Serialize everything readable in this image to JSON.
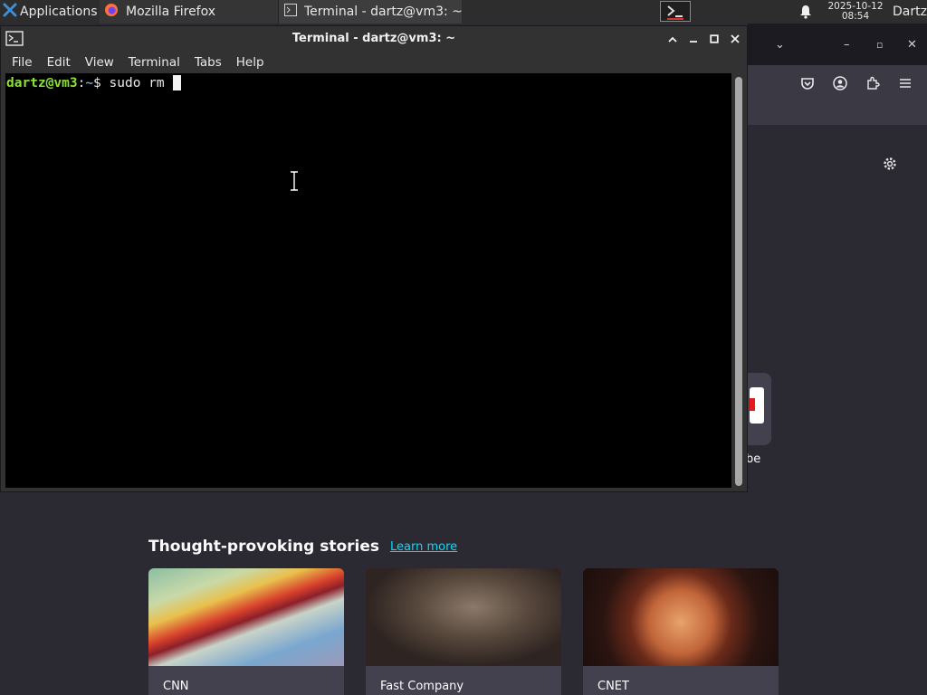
{
  "panel": {
    "applications_label": "Applications",
    "applications_arrow": "≡",
    "tasks": [
      {
        "label": "Mozilla Firefox",
        "icon": "firefox-icon"
      },
      {
        "label": "Terminal - dartz@vm3: ~",
        "icon": "terminal-icon"
      }
    ],
    "clock_date": "2025-10-12",
    "clock_time": "08:54",
    "user": "Dartz"
  },
  "terminal": {
    "title": "Terminal - dartz@vm3: ~",
    "menu": [
      "File",
      "Edit",
      "View",
      "Terminal",
      "Tabs",
      "Help"
    ],
    "prompt_user": "dartz@vm3",
    "prompt_sep": ":",
    "prompt_path": "~",
    "prompt_symbol": "$",
    "command": "sudo rm "
  },
  "firefox": {
    "shortcut_label": "be",
    "stories_heading": "Thought-provoking stories",
    "learn_more": "Learn more",
    "stories": [
      {
        "source": "CNN"
      },
      {
        "source": "Fast Company"
      },
      {
        "source": "CNET"
      }
    ]
  },
  "colors": {
    "panel_bg": "#2d2d2d",
    "terminal_bg": "#000000",
    "prompt_user": "#8ae234",
    "prompt_path": "#729fcf",
    "firefox_bg": "#2b2a33",
    "link": "#00ddff"
  }
}
